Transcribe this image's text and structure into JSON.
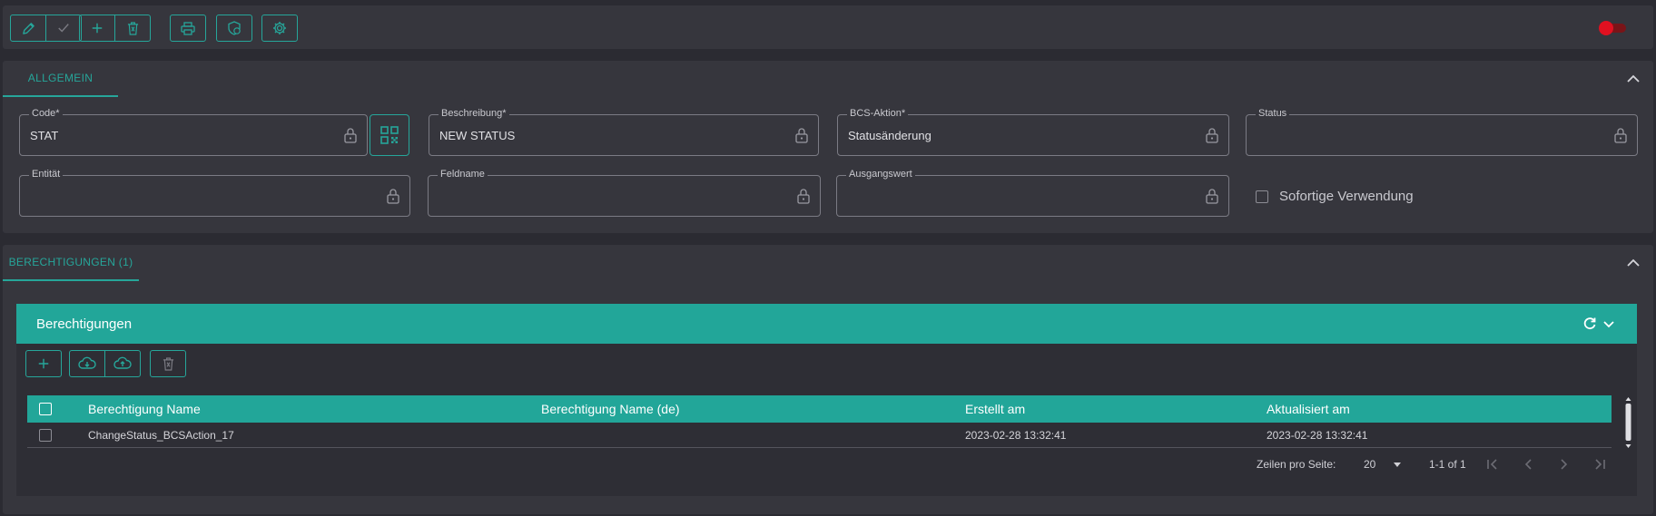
{
  "toolbar": {
    "edit_icon": "pencil-icon",
    "save_icon": "check-icon",
    "add_icon": "plus-icon",
    "delete_icon": "trash-icon",
    "print_icon": "printer-icon",
    "shield_icon": "shield-lock-icon",
    "settings_icon": "gear-icon",
    "toggle_state": "off",
    "accent": "#26a69a"
  },
  "general": {
    "tab_label": "ALLGEMEIN",
    "fields": {
      "code": {
        "label": "Code*",
        "value": "STAT"
      },
      "description": {
        "label": "Beschreibung*",
        "value": "NEW STATUS"
      },
      "bcs_action": {
        "label": "BCS-Aktion*",
        "value": "Statusänderung"
      },
      "status": {
        "label": "Status",
        "value": ""
      },
      "entity": {
        "label": "Entität",
        "value": ""
      },
      "field_name": {
        "label": "Feldname",
        "value": ""
      },
      "output_value": {
        "label": "Ausgangswert",
        "value": ""
      }
    },
    "immediate_use": {
      "label": "Sofortige Verwendung",
      "checked": false
    }
  },
  "permissions_section": {
    "tab_label": "BERECHTIGUNGEN (1)",
    "card_title": "Berechtigungen",
    "columns": [
      "Berechtigung Name",
      "Berechtigung Name (de)",
      "Erstellt am",
      "Aktualisiert am"
    ],
    "rows": [
      {
        "name": "ChangeStatus_BCSAction_17",
        "name_de": "",
        "created": "2023-02-28 13:32:41",
        "updated": "2023-02-28 13:32:41"
      }
    ],
    "pagination": {
      "rows_per_page_label": "Zeilen pro Seite:",
      "rows_per_page": "20",
      "range": "1-1 of 1"
    }
  }
}
